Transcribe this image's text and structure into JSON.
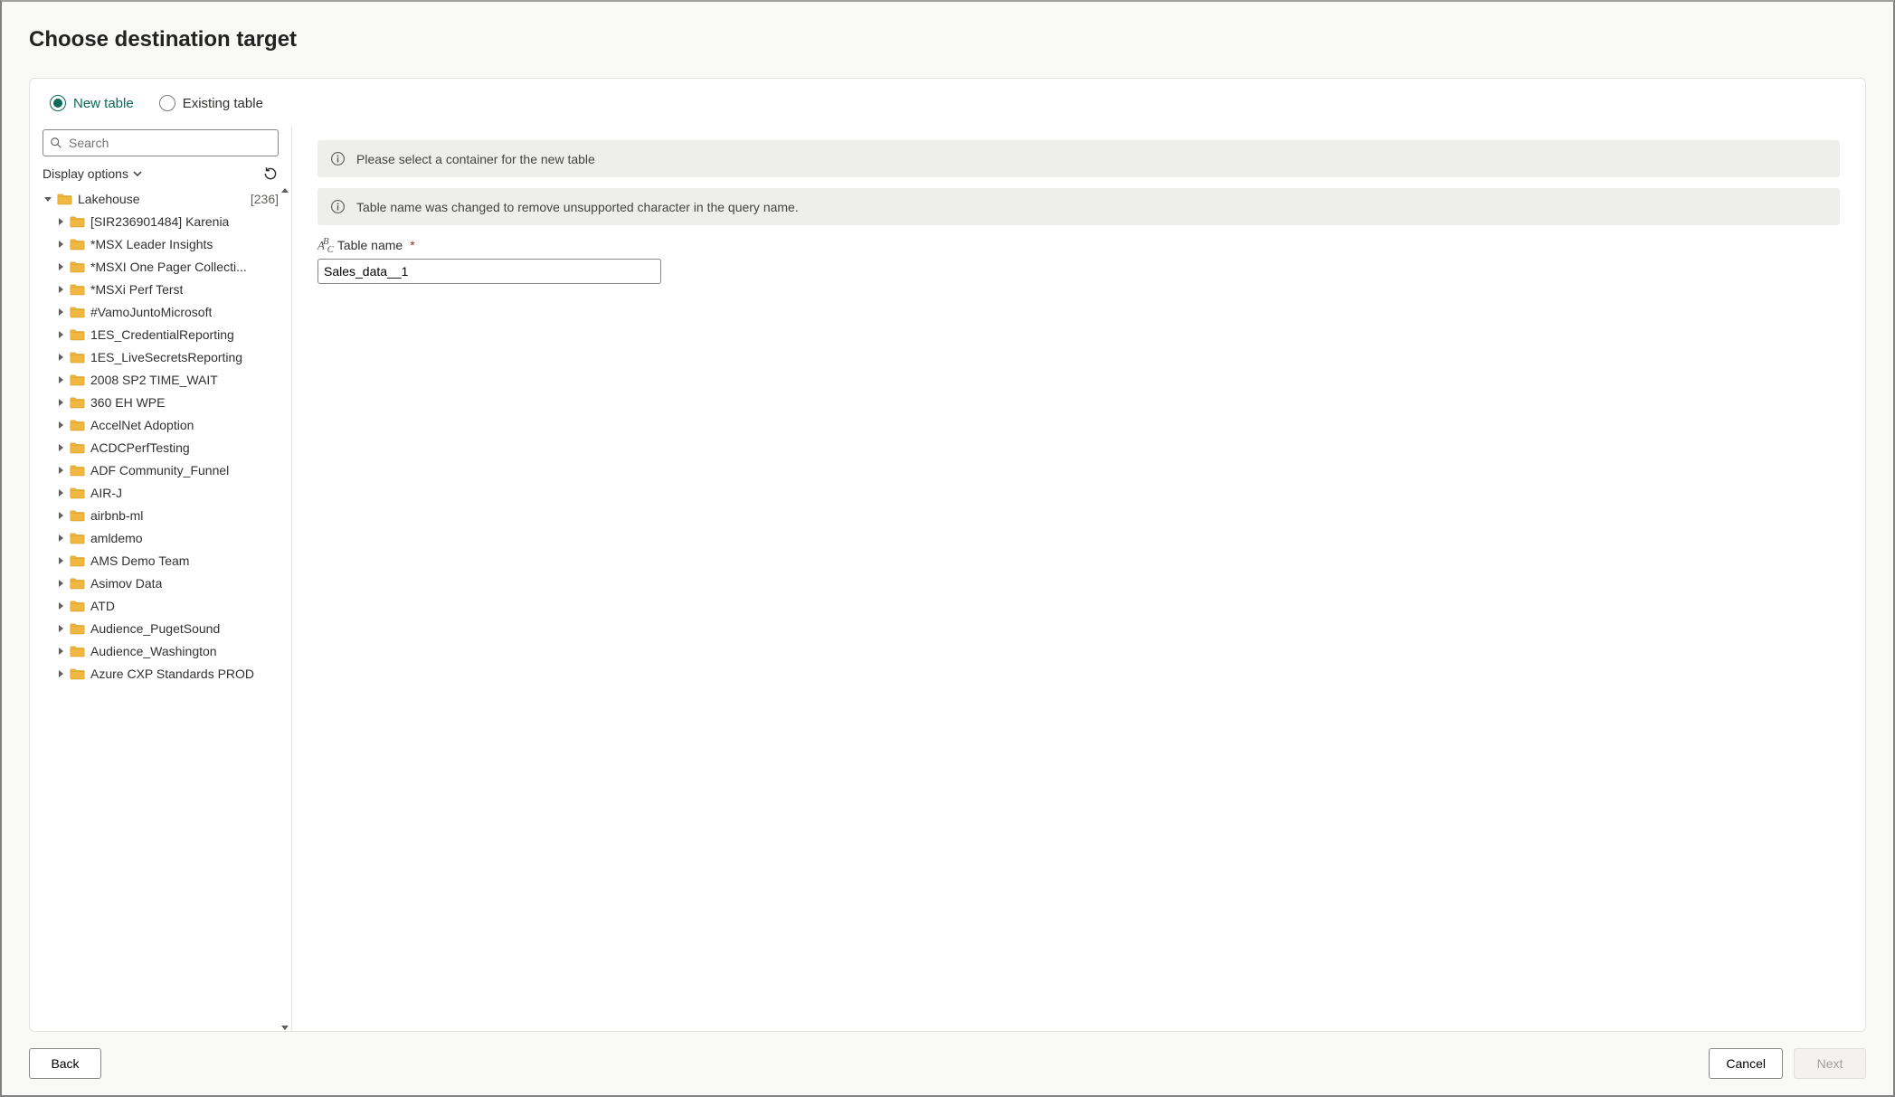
{
  "header": {
    "title": "Choose destination target"
  },
  "tabs": {
    "new_table": "New table",
    "existing_table": "Existing table",
    "selected": "new_table"
  },
  "sidebar": {
    "search_placeholder": "Search",
    "display_options": "Display options",
    "root": {
      "label": "Lakehouse",
      "count": "[236]"
    },
    "items": [
      {
        "label": "[SIR236901484] Karenia"
      },
      {
        "label": "*MSX Leader Insights"
      },
      {
        "label": "*MSXI One Pager Collecti..."
      },
      {
        "label": "*MSXi Perf Terst"
      },
      {
        "label": "#VamoJuntoMicrosoft"
      },
      {
        "label": "1ES_CredentialReporting"
      },
      {
        "label": "1ES_LiveSecretsReporting"
      },
      {
        "label": "2008 SP2 TIME_WAIT"
      },
      {
        "label": "360 EH WPE"
      },
      {
        "label": "AccelNet Adoption"
      },
      {
        "label": "ACDCPerfTesting"
      },
      {
        "label": "ADF Community_Funnel"
      },
      {
        "label": "AIR-J"
      },
      {
        "label": "airbnb-ml"
      },
      {
        "label": "amldemo"
      },
      {
        "label": "AMS Demo Team"
      },
      {
        "label": "Asimov Data"
      },
      {
        "label": "ATD"
      },
      {
        "label": "Audience_PugetSound"
      },
      {
        "label": "Audience_Washington"
      },
      {
        "label": "Azure CXP Standards PROD"
      }
    ]
  },
  "main": {
    "info1": "Please select a container for the new table",
    "info2": "Table name was changed to remove unsupported character in the query name.",
    "table_name_label": "Table name",
    "table_name_value": "Sales_data__1"
  },
  "footer": {
    "back": "Back",
    "cancel": "Cancel",
    "next": "Next"
  }
}
